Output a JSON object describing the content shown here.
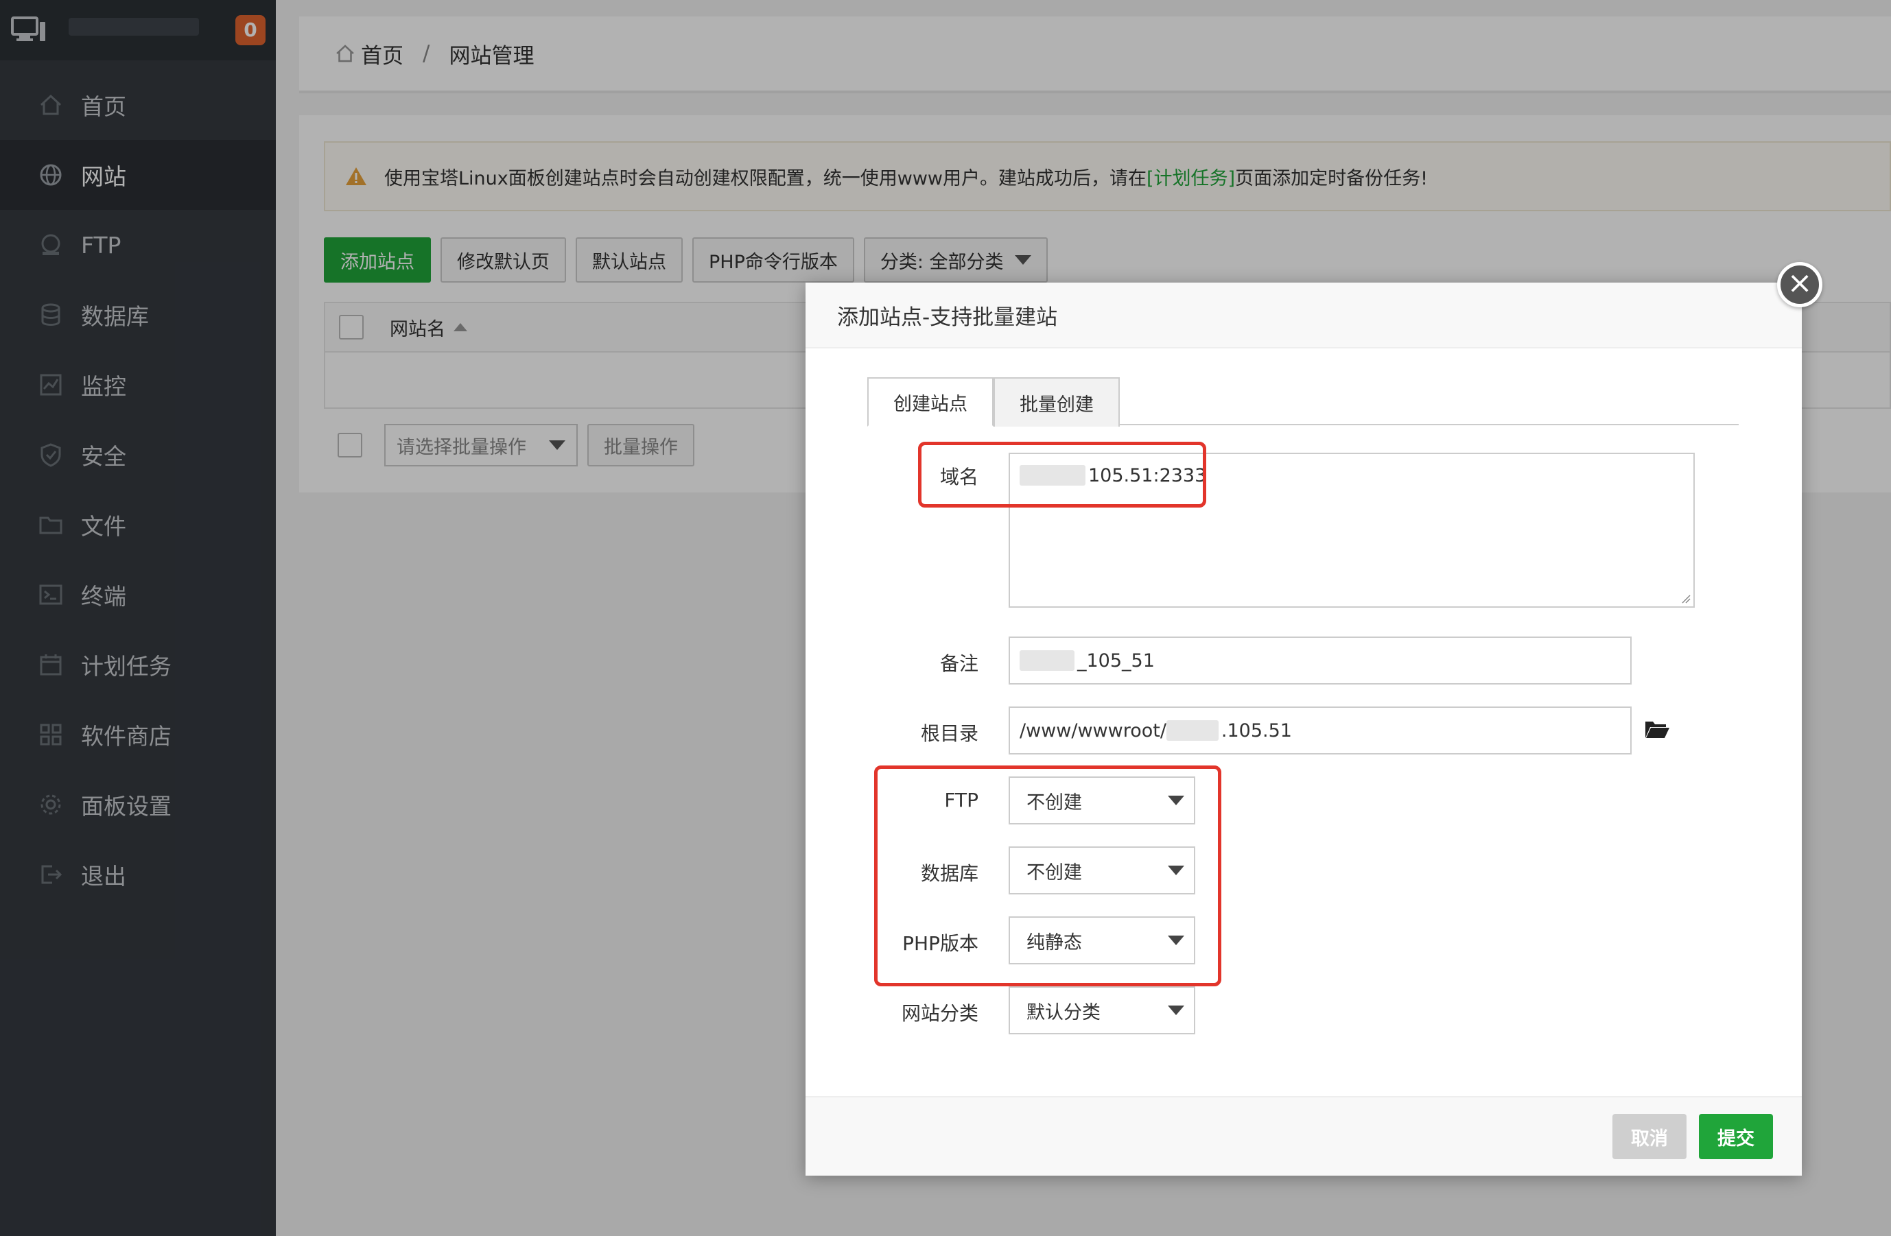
{
  "sidebar": {
    "badge_count": "0",
    "items": [
      {
        "label": "首页",
        "icon": "home-icon"
      },
      {
        "label": "网站",
        "icon": "globe-icon",
        "active": true
      },
      {
        "label": "FTP",
        "icon": "ftp-icon"
      },
      {
        "label": "数据库",
        "icon": "database-icon"
      },
      {
        "label": "监控",
        "icon": "monitor-icon"
      },
      {
        "label": "安全",
        "icon": "shield-icon"
      },
      {
        "label": "文件",
        "icon": "folder-icon"
      },
      {
        "label": "终端",
        "icon": "terminal-icon"
      },
      {
        "label": "计划任务",
        "icon": "calendar-icon"
      },
      {
        "label": "软件商店",
        "icon": "apps-icon"
      },
      {
        "label": "面板设置",
        "icon": "gear-icon"
      },
      {
        "label": "退出",
        "icon": "logout-icon"
      }
    ]
  },
  "breadcrumb": {
    "home": "首页",
    "separator": "/",
    "current": "网站管理"
  },
  "warning": {
    "text_before": "使用宝塔Linux面板创建站点时会自动创建权限配置，统一使用www用户。建站成功后，请在",
    "link": "[计划任务]",
    "text_after": "页面添加定时备份任务!"
  },
  "toolbar": {
    "add_site": "添加站点",
    "modify_default": "修改默认页",
    "default_site": "默认站点",
    "php_cli": "PHP命令行版本",
    "category": "分类: 全部分类"
  },
  "table": {
    "col_name": "网站名"
  },
  "batch": {
    "select_placeholder": "请选择批量操作",
    "button": "批量操作"
  },
  "modal": {
    "title": "添加站点-支持批量建站",
    "tabs": [
      "创建站点",
      "批量创建"
    ],
    "fields": {
      "domain_label": "域名",
      "domain_value": "105.51:2333",
      "remark_label": "备注",
      "remark_value": "_105_51",
      "root_label": "根目录",
      "root_prefix": "/www/wwwroot/",
      "root_suffix": ".105.51",
      "ftp_label": "FTP",
      "ftp_value": "不创建",
      "db_label": "数据库",
      "db_value": "不创建",
      "php_label": "PHP版本",
      "php_value": "纯静态",
      "cat_label": "网站分类",
      "cat_value": "默认分类"
    },
    "cancel": "取消",
    "submit": "提交",
    "close": "×"
  },
  "colors": {
    "accent": "#20a53a",
    "highlight": "#e2352b",
    "badge": "#e0632f",
    "sidebar": "#353a40"
  }
}
